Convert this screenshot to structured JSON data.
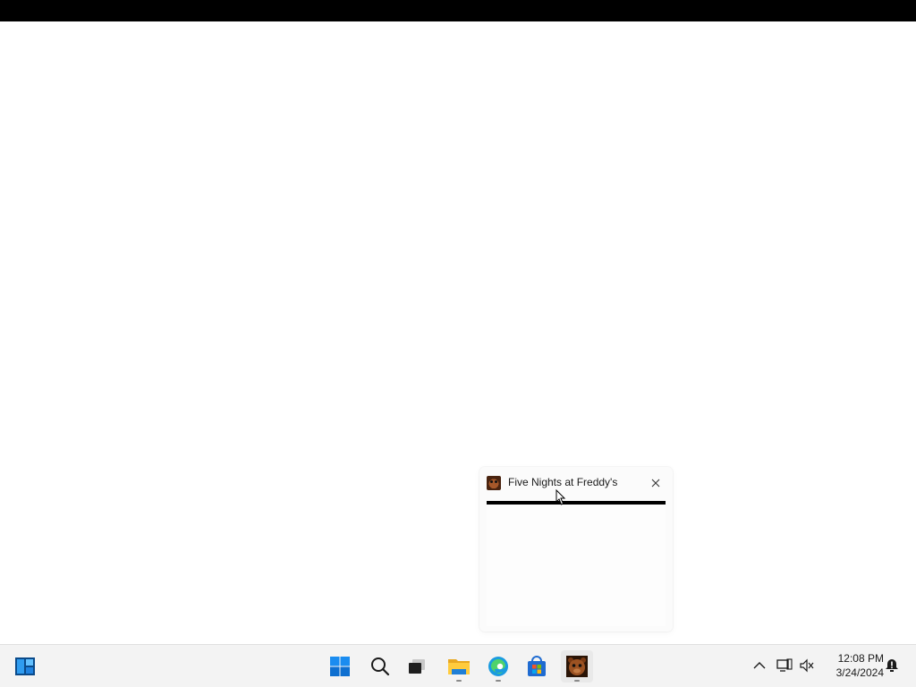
{
  "preview": {
    "title": "Five Nights at Freddy's",
    "app_icon": "freddy-app-icon",
    "close_icon": "close-icon"
  },
  "taskbar": {
    "widgets_icon": "widgets-icon",
    "pinned": [
      {
        "name": "start-button",
        "icon": "windows-logo-icon"
      },
      {
        "name": "search-button",
        "icon": "search-icon"
      },
      {
        "name": "task-view-button",
        "icon": "task-view-icon"
      },
      {
        "name": "file-explorer-button",
        "icon": "folder-icon"
      },
      {
        "name": "edge-button",
        "icon": "edge-icon"
      },
      {
        "name": "store-button",
        "icon": "store-icon"
      },
      {
        "name": "fnaf-button",
        "icon": "freddy-app-icon"
      }
    ],
    "tray": {
      "chevron_icon": "chevron-up-icon",
      "network_icon": "network-icon",
      "volume_icon": "volume-muted-icon",
      "notification_icon": "notification-icon"
    },
    "clock": {
      "time": "12:08 PM",
      "date": "3/24/2024"
    }
  },
  "colors": {
    "accent_blue": "#0078d4",
    "taskbar_bg": "#f3f3f3",
    "top_bar": "#000000"
  }
}
